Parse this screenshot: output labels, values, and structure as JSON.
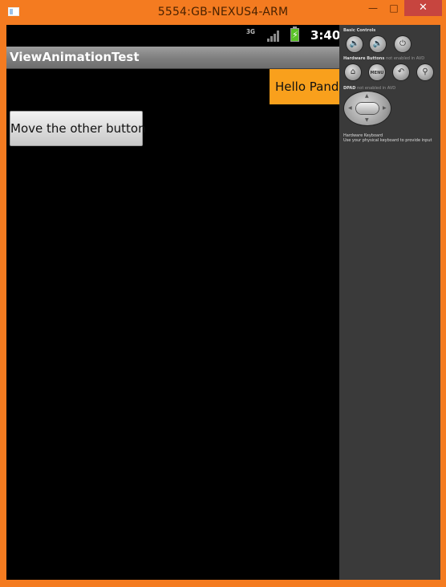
{
  "window": {
    "title": "5554:GB-NEXUS4-ARM",
    "minimize_glyph": "—",
    "maximize_glyph": "□",
    "close_glyph": "✕"
  },
  "statusbar": {
    "network": "3G",
    "battery_glyph": "⚡",
    "time": "3:40"
  },
  "app": {
    "title": "ViewAnimationTest",
    "hello_button": "Hello Pandora",
    "move_button": "Move the other button"
  },
  "controls": {
    "basic_label": "Basic Controls",
    "hardware_label": "Hardware Buttons",
    "hardware_note": "not enabled in AVD",
    "menu_label": "MENU",
    "dpad_label": "DPAD",
    "dpad_note": "not enabled in AVD",
    "keyboard_label": "Hardware Keyboard",
    "keyboard_desc": "Use your physical keyboard to provide input"
  },
  "colors": {
    "window_frame": "#F47B20",
    "hello_button_bg": "#F9A01C",
    "close_button": "#C7453F",
    "controls_bg": "#3A3A3A"
  }
}
